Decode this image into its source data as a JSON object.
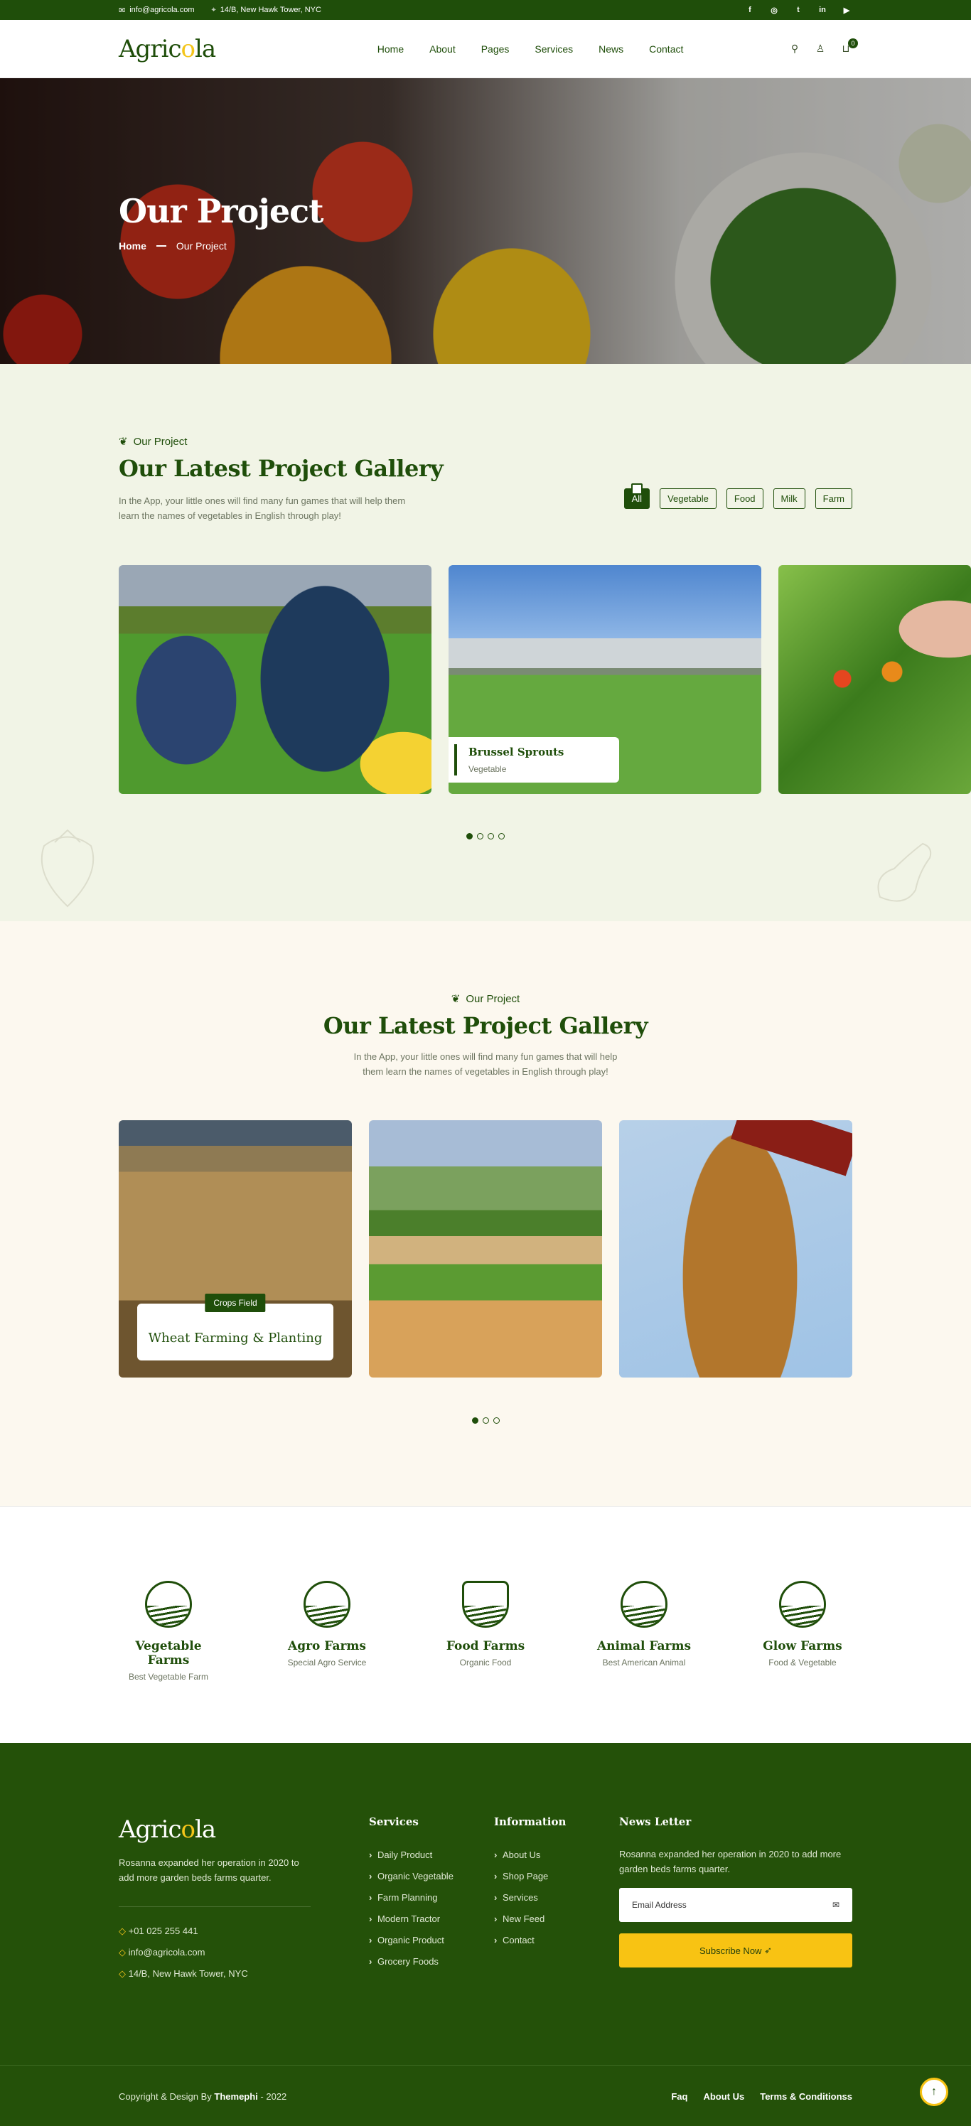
{
  "topbar": {
    "email": "info@agricola.com",
    "address": "14/B, New Hawk Tower, NYC",
    "social": [
      "f",
      "◎",
      "t",
      "in",
      "▶"
    ]
  },
  "header": {
    "logo_a": "Agric",
    "logo_o": "o",
    "logo_b": "la",
    "nav": [
      "Home",
      "About",
      "Pages",
      "Services",
      "News",
      "Contact"
    ],
    "cart_count": "0"
  },
  "hero": {
    "title": "Our Project",
    "crumb_home": "Home",
    "crumb_current": "Our Project"
  },
  "section1": {
    "kicker": "Our Project",
    "title": "Our Latest Project Gallery",
    "desc": "In the App, your little ones will find many fun games that will help them learn the names of vegetables in English through play!",
    "filters": [
      "All",
      "Vegetable",
      "Food",
      "Milk",
      "Farm"
    ],
    "card_title": "Brussel Sprouts",
    "card_sub": "Vegetable"
  },
  "section2": {
    "kicker": "Our Project",
    "title": "Our Latest Project Gallery",
    "desc": "In the App, your little ones will find many fun games that will help them learn the names of vegetables in English through play!",
    "card_tag": "Crops Field",
    "card_title": "Wheat Farming & Planting"
  },
  "brands": [
    {
      "name": "Vegetable Farms",
      "sub": "Best Vegetable Farm"
    },
    {
      "name": "Agro Farms",
      "sub": "Special Agro Service"
    },
    {
      "name": "Food Farms",
      "sub": "Organic Food"
    },
    {
      "name": "Animal Farms",
      "sub": "Best American Animal"
    },
    {
      "name": "Glow Farms",
      "sub": "Food & Vegetable"
    }
  ],
  "footer": {
    "logo_a": "Agric",
    "logo_o": "o",
    "logo_b": "la",
    "desc": "Rosanna expanded her operation in 2020 to add more garden beds farms quarter.",
    "phone": "+01 025 255 441",
    "email": "info@agricola.com",
    "address": "14/B, New Hawk Tower, NYC",
    "services_title": "Services",
    "services": [
      "Daily Product",
      "Organic Vegetable",
      "Farm Planning",
      "Modern Tractor",
      "Organic Product",
      "Grocery Foods"
    ],
    "info_title": "Information",
    "info": [
      "About Us",
      "Shop Page",
      "Services",
      "New Feed",
      "Contact"
    ],
    "news_title": "News Letter",
    "news_desc": "Rosanna expanded her operation in 2020 to add more garden beds farms quarter.",
    "email_placeholder": "Email Address",
    "subscribe": "Subscribe Now",
    "copy_a": "Copyright & Design By ",
    "copy_b": "Themephi",
    "copy_c": " - 2022",
    "links": [
      "Faq",
      "About Us",
      "Terms & Conditionss"
    ]
  }
}
